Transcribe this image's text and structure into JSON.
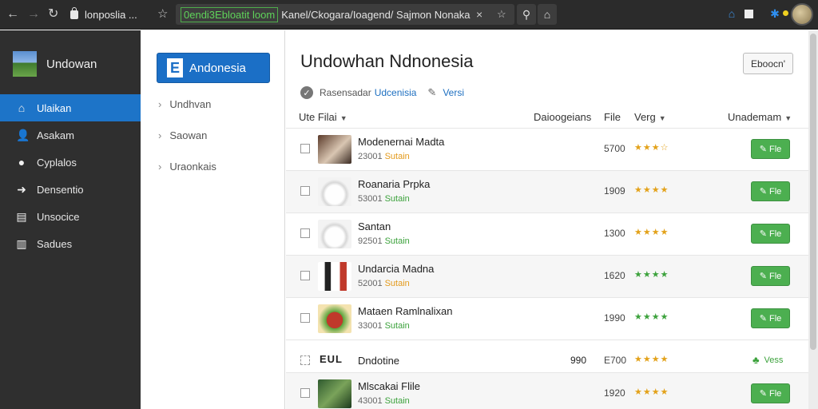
{
  "browser": {
    "tab_title": "lonposlia ...",
    "url_highlight": "0endi3Ebloatit loom",
    "url_rest": "Kanel/Ckogara/Ioagend/ Sajmon Nonaka",
    "url_close": "×"
  },
  "sidebar": {
    "brand": "Undowan",
    "items": [
      {
        "label": "Ulaikan",
        "icon": "home-icon",
        "glyph": "⌂"
      },
      {
        "label": "Asakam",
        "icon": "user-icon",
        "glyph": "👤"
      },
      {
        "label": "Cyplalos",
        "icon": "info-icon",
        "glyph": "●"
      },
      {
        "label": "Densentio",
        "icon": "login-icon",
        "glyph": "➜"
      },
      {
        "label": "Unsocice",
        "icon": "document-icon",
        "glyph": "▤"
      },
      {
        "label": "Sadues",
        "icon": "chart-icon",
        "glyph": "▥"
      }
    ],
    "active_index": 0
  },
  "subpanel": {
    "button_badge": "E",
    "button_label": "Andonesia",
    "items": [
      "Undhvan",
      "Saowan",
      "Uraonkais"
    ]
  },
  "main": {
    "title": "Undowhan Ndnonesia",
    "top_button": "Eboocn'",
    "meta_prefix": "Rasensadar",
    "meta_link": "Udcenisia",
    "meta_pin_label": "Versi",
    "columns": {
      "name": "Ute Filai",
      "categories": "Daioogeians",
      "file": "File",
      "verg": "Verg",
      "action": "Unademam"
    },
    "rows": [
      {
        "name": "Modenernai Madta",
        "id": "23001",
        "status": "Sutain",
        "status_color": "orange",
        "size": "5700",
        "stars": "★★★☆",
        "stars_color": "#e3a21a",
        "action": "Fle",
        "thumb": "t-dark"
      },
      {
        "name": "Roanaria Prpka",
        "id": "53001",
        "status": "Sutain",
        "status_color": "green",
        "size": "1909",
        "stars": "★★★★",
        "stars_color": "#e3a21a",
        "action": "Fle",
        "thumb": "t-cup"
      },
      {
        "name": "Santan",
        "id": "92501",
        "status": "Sutain",
        "status_color": "green",
        "size": "1300",
        "stars": "★★★★",
        "stars_color": "#e3a21a",
        "action": "Fle",
        "thumb": "t-cup"
      },
      {
        "name": "Undarcia Madna",
        "id": "52001",
        "status": "Sutain",
        "status_color": "orange",
        "size": "1620",
        "stars": "★★★★",
        "stars_color": "#3ca23c",
        "action": "Fle",
        "thumb": "t-phone"
      },
      {
        "name": "Mataen Ramlnalixan",
        "id": "33001",
        "status": "Sutain",
        "status_color": "green",
        "size": "1990",
        "stars": "★★★★",
        "stars_color": "#3ca23c",
        "action": "Fle",
        "thumb": "t-red"
      },
      {
        "name": "Dndotine",
        "thumb_text": "EUL",
        "size_left": "990",
        "size": "E700",
        "stars": "★★★★",
        "stars_color": "#e3a21a",
        "action_link": "Vess"
      },
      {
        "name": "Mlscakai Flile",
        "id": "43001",
        "status": "Sutain",
        "status_color": "green",
        "size": "1920",
        "stars": "★★★★",
        "stars_color": "#e3a21a",
        "action": "Fle",
        "thumb": "t-game"
      }
    ]
  }
}
